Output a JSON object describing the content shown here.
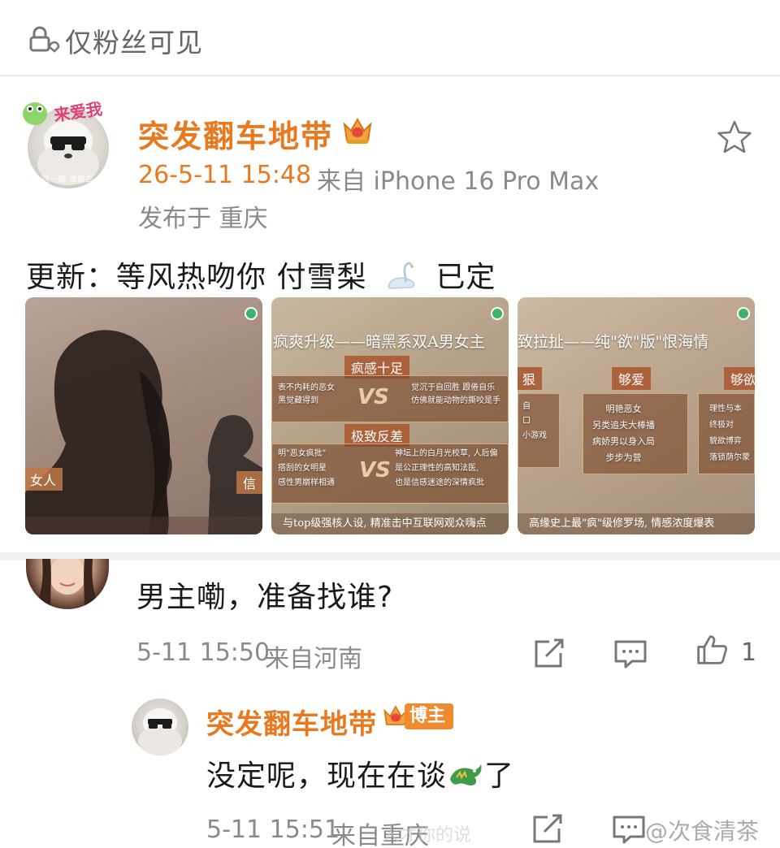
{
  "privacy": {
    "icon": "lock-people-icon",
    "label": "仅粉丝可见"
  },
  "post": {
    "author": "突发翻车地带",
    "author_avatar_sticker": "来爱我",
    "author_avatar_caption": "这一截 谁敢去",
    "crown_icon": "crown-icon",
    "time": "26-5-11 15:48",
    "source": "来自 iPhone 16 Pro Max",
    "location": "发布于 重庆",
    "text_before": "更新：等风热吻你 付雪梨",
    "text_after": "已定",
    "inline_icon": "swan-icon",
    "star_icon": "star-icon",
    "images": [
      {
        "name": "image-1",
        "label": "女人",
        "side_label": "信"
      },
      {
        "name": "image-2",
        "headline": "疯爽升级——暗黑系双A男女主",
        "tag1": "疯感十足",
        "tag2": "极致反差",
        "vs": "VS",
        "row1_left": "表不内耗的恶女\n黑觉藏得到",
        "row1_right": "觉沉于自回胜 跟倦自乐\n仿佛就能动物的撕咬是手",
        "row2_left": "明\"恶女疯批\"\n搭刮的女明星\n感性男崩样相通",
        "row2_right": "神坛上的白月光校草, 人后偏\n是公正理性的高知法医,\n也是信感迷途的深情疯批",
        "caption": "与top级强核人设, 精准击中互联网观众嗨点"
      },
      {
        "name": "image-3",
        "headline": "致拉扯——纯\"欲\"版\"恨海情",
        "tag1": "够爱",
        "tag2": "够欲",
        "tag_left": "狠",
        "box_left": "自\n口\n小游戏",
        "box_mid": "明艳恶女\n另类追夫大棒播\n病娇男以身入局\n步步为营",
        "box_right": "理性与本\n终极对\n貌欲博弈\n落锁荫尔蒙",
        "caption": "高缘史上最\"疯\"级修罗场, 情感浓度爆表"
      }
    ]
  },
  "comments": [
    {
      "text": "男主嘞，准备找谁?",
      "time": "5-11 15:50",
      "source": "来自河南",
      "like_count": "1",
      "share_icon": "share-icon",
      "comment_icon": "comment-icon",
      "like_icon": "thumbs-up-icon",
      "reply": {
        "author": "突发翻车地带",
        "badge": "博主",
        "text_before": "没定呢，现在在谈",
        "text_after": "了",
        "inline_icon": "dragon-icon",
        "time": "5-11 15:51",
        "source": "来自重庆"
      }
    }
  ],
  "watermark": "@次食清茶",
  "watermark_faint": "人才你的说"
}
